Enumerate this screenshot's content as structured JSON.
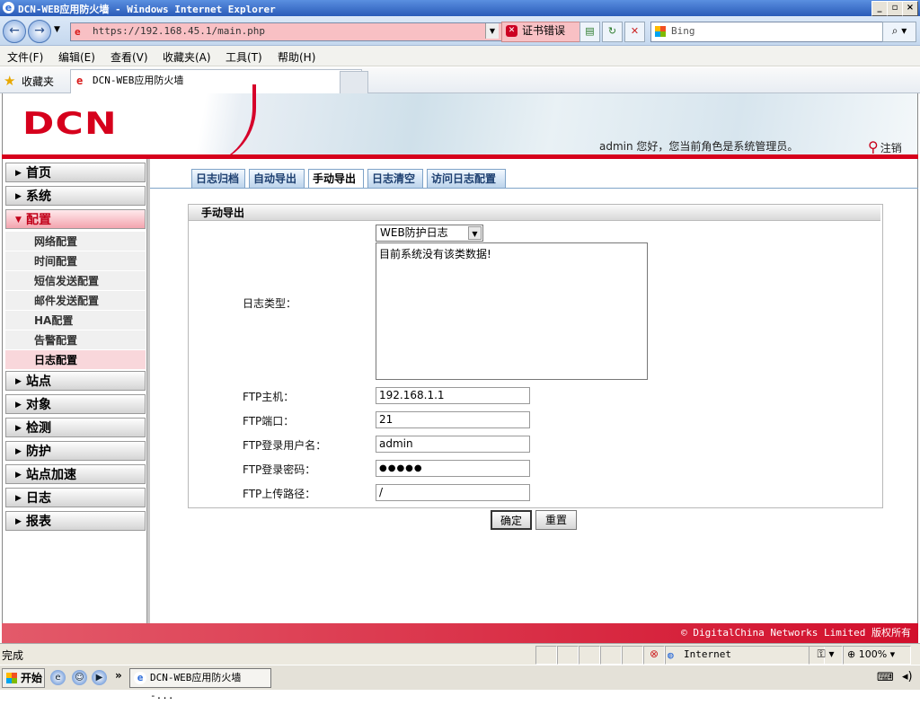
{
  "window": {
    "title": "DCN-WEB应用防火墙 - Windows Internet Explorer",
    "min": "_",
    "max": "▫",
    "close": "×"
  },
  "browser": {
    "url": "https://192.168.45.1/main.php",
    "cert_error": "证书错误",
    "search_engine": "Bing",
    "menus": [
      "文件(F)",
      "编辑(E)",
      "查看(V)",
      "收藏夹(A)",
      "工具(T)",
      "帮助(H)"
    ],
    "favorites_label": "收藏夹",
    "tab_title": "DCN-WEB应用防火墙"
  },
  "header": {
    "logo": "DCN",
    "welcome": "admin 您好，您当前角色是系统管理员。",
    "logout": "注销"
  },
  "sidebar": {
    "items": [
      {
        "label": "首页",
        "active": false
      },
      {
        "label": "系统",
        "active": false
      },
      {
        "label": "配置",
        "active": true
      },
      {
        "label": "站点",
        "active": false
      },
      {
        "label": "对象",
        "active": false
      },
      {
        "label": "检测",
        "active": false
      },
      {
        "label": "防护",
        "active": false
      },
      {
        "label": "站点加速",
        "active": false
      },
      {
        "label": "日志",
        "active": false
      },
      {
        "label": "报表",
        "active": false
      }
    ],
    "sub_items": [
      {
        "label": "网络配置",
        "active": false
      },
      {
        "label": "时间配置",
        "active": false
      },
      {
        "label": "短信发送配置",
        "active": false
      },
      {
        "label": "邮件发送配置",
        "active": false
      },
      {
        "label": "HA配置",
        "active": false
      },
      {
        "label": "告警配置",
        "active": false
      },
      {
        "label": "日志配置",
        "active": true
      }
    ]
  },
  "tabs": [
    {
      "label": "日志归档",
      "active": false
    },
    {
      "label": "自动导出",
      "active": false
    },
    {
      "label": "手动导出",
      "active": true
    },
    {
      "label": "日志清空",
      "active": false
    },
    {
      "label": "访问日志配置",
      "active": false
    }
  ],
  "form": {
    "title": "手动导出",
    "log_type_label": "日志类型：",
    "log_type_value": "WEB防护日志",
    "log_content": "目前系统没有该类数据!",
    "ftp_host_label": "FTP主机：",
    "ftp_host": "192.168.1.1",
    "ftp_port_label": "FTP端口：",
    "ftp_port": "21",
    "ftp_user_label": "FTP登录用户名：",
    "ftp_user": "admin",
    "ftp_pass_label": "FTP登录密码：",
    "ftp_pass": "●●●●●",
    "ftp_path_label": "FTP上传路径：",
    "ftp_path": "/",
    "confirm": "确定",
    "reset": "重置"
  },
  "footer": {
    "copyright": "© DigitalChina Networks Limited 版权所有"
  },
  "statusbar": {
    "status": "完成",
    "zone": "Internet",
    "zoom": "100%"
  },
  "taskbar": {
    "start": "开始",
    "task": "DCN-WEB应用防火墙 -..."
  }
}
